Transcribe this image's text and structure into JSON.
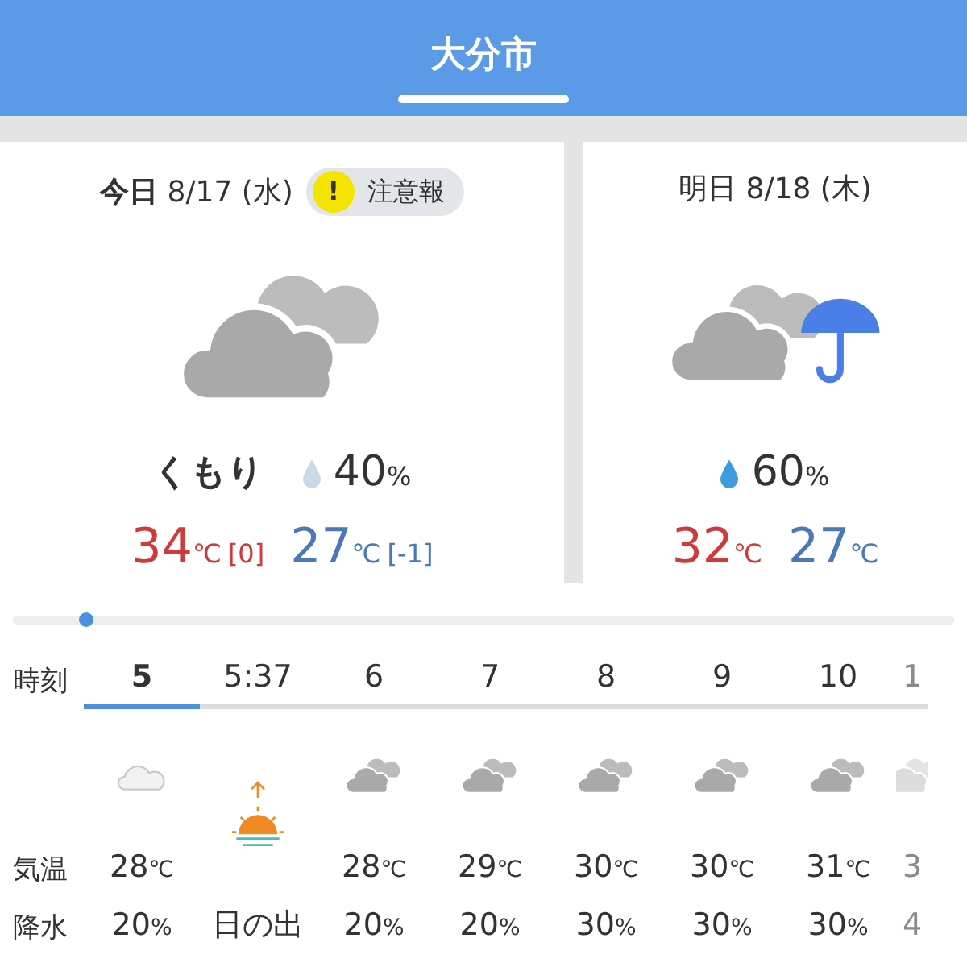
{
  "header": {
    "title": "大分市"
  },
  "days": [
    {
      "kind": "cloudy",
      "label": "今日",
      "date": "8/17 (水)",
      "alert": {
        "icon": "!",
        "text": "注意報"
      },
      "weather": "くもり",
      "color": "#c9d9e6",
      "precip": "40",
      "precip_unit": "%",
      "high": "34",
      "high_unit": "℃",
      "high_diff": "[0]",
      "low": "27",
      "low_unit": "℃",
      "low_diff": "[-1]"
    },
    {
      "kind": "rain",
      "label": "明日",
      "date": "8/18 (木)",
      "color": "#3d9be0",
      "precip": "60",
      "precip_unit": "%",
      "high": "32",
      "high_unit": "℃",
      "low": "27",
      "low_unit": "℃"
    }
  ],
  "timeline": {
    "level": 0.07
  },
  "hourly": {
    "labels": [
      "時刻",
      "気温",
      "降水"
    ],
    "columns": [
      {
        "kind": "light-cloud",
        "time": "5",
        "selected": true,
        "temp": "28",
        "temp_unit": "℃",
        "precip": "20",
        "precip_unit": "%"
      },
      {
        "kind": "sunrise",
        "time": "5:37",
        "selected": false,
        "event": "日の出"
      },
      {
        "kind": "cloudy",
        "time": "6",
        "selected": false,
        "temp": "28",
        "temp_unit": "℃",
        "precip": "20",
        "precip_unit": "%"
      },
      {
        "kind": "cloudy",
        "time": "7",
        "selected": false,
        "temp": "29",
        "temp_unit": "℃",
        "precip": "20",
        "precip_unit": "%"
      },
      {
        "kind": "cloudy",
        "time": "8",
        "selected": false,
        "temp": "30",
        "temp_unit": "℃",
        "precip": "30",
        "precip_unit": "%"
      },
      {
        "kind": "cloudy",
        "time": "9",
        "selected": false,
        "temp": "30",
        "temp_unit": "℃",
        "precip": "30",
        "precip_unit": "%"
      },
      {
        "kind": "cloudy",
        "time": "10",
        "selected": false,
        "temp": "31",
        "temp_unit": "℃",
        "precip": "30",
        "precip_unit": "%"
      },
      {
        "kind": "faded",
        "time": "1",
        "selected": false,
        "temp": "3",
        "precip": "4"
      }
    ]
  }
}
